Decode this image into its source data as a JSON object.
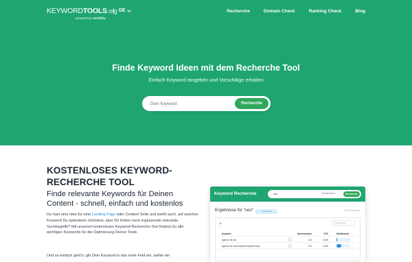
{
  "brand": {
    "name_a": "KEYWORD",
    "name_b": "TOOLS",
    "name_c": ".org",
    "powered_prefix": "powered by",
    "powered_by": "seobility"
  },
  "nav": {
    "lang": "DE",
    "links": [
      "Recherche",
      "Domain Check",
      "Ranking Check",
      "Blog"
    ]
  },
  "hero": {
    "title": "Finde Keyword Ideen mit dem Recherche Tool",
    "subtitle": "Einfach Keyword eingeben und Vorschläge erhalten",
    "search_placeholder": "Dein Keyword",
    "search_button": "Recherche"
  },
  "content": {
    "heading": "KOSTENLOSES KEYWORD-RECHERCHE TOOL",
    "subheading": "Finde relevante Keywords für Deinen Content - schnell, einfach und kostenlos",
    "para_before_link": "Du hast eine Idee für eine ",
    "para_link": "Landing Page",
    "para_after_link": " oder Content Seite und weißt auch, auf welches Keyword Du optimieren möchtest, aber Dir fehlen noch ergänzende relevante Suchbegriffe? Mit unserem kostenlosen Keyword-Recherche-Tool findest Du alle wichtigen Keywords für die Optimierung Deiner Texte.",
    "para2": "Und so einfach geht's: gib Dein Keyword in das erste Feld ein, wähle ein"
  },
  "preview": {
    "title": "Keyword Recherche",
    "query": "seo",
    "country": "Deutschland",
    "button": "Recherche",
    "results_title": "Ergebnisse für \"seo\"",
    "badge": "1 Keyword",
    "csv": "CSV Download",
    "count": "8",
    "filter_placeholder": "Suchbegriffe...",
    "columns": [
      "Keyword",
      "Suchvolumen",
      "CPC",
      "Wettbewerb"
    ],
    "rows": [
      {
        "keyword": "agentur für seo",
        "volume": "110",
        "cpc": "0,00€",
        "competition": 0.05
      },
      {
        "keyword": "agentur für suchmaschinenoptimierung",
        "volume": "170",
        "cpc": "0,00€",
        "competition": 0.35
      }
    ]
  },
  "colors": {
    "primary": "#1fa570",
    "button": "#2fa85c",
    "link": "#2c8fd6"
  }
}
